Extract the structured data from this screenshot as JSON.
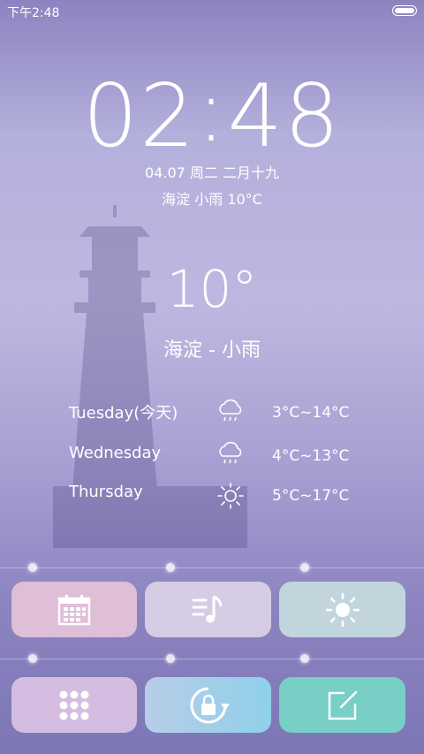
{
  "status_bar": {
    "time": "下午2:48",
    "battery_icon": "battery-icon"
  },
  "clock": {
    "hours": "02",
    "colon": ":",
    "minutes": "48"
  },
  "date_line": "04.07 周二 二月十九",
  "location_weather_line": "海淀 小雨 10°C",
  "current": {
    "temperature": "10°",
    "city_condition": "海淀 - 小雨"
  },
  "forecast": [
    {
      "day": "Tuesday(今天)",
      "icon": "rain-cloud-icon",
      "range": "3°C~14°C"
    },
    {
      "day": "Wednesday",
      "icon": "rain-cloud-icon",
      "range": "4°C~13°C"
    },
    {
      "day": "Thursday",
      "icon": "sun-icon",
      "range": "5°C~17°C"
    }
  ],
  "shortcuts_row1": [
    {
      "icon": "calendar-icon",
      "color": "#e2c0d8"
    },
    {
      "icon": "music-icon",
      "color": "#d9cfe3"
    },
    {
      "icon": "brightness-icon",
      "color": "#c4d8dc"
    }
  ],
  "shortcuts_row2": [
    {
      "icon": "app-grid-icon",
      "color": "#dcc0e4"
    },
    {
      "icon": "rotation-lock-icon",
      "color": "#9fd4e6"
    },
    {
      "icon": "notes-icon",
      "color": "#7fd1c8"
    }
  ]
}
